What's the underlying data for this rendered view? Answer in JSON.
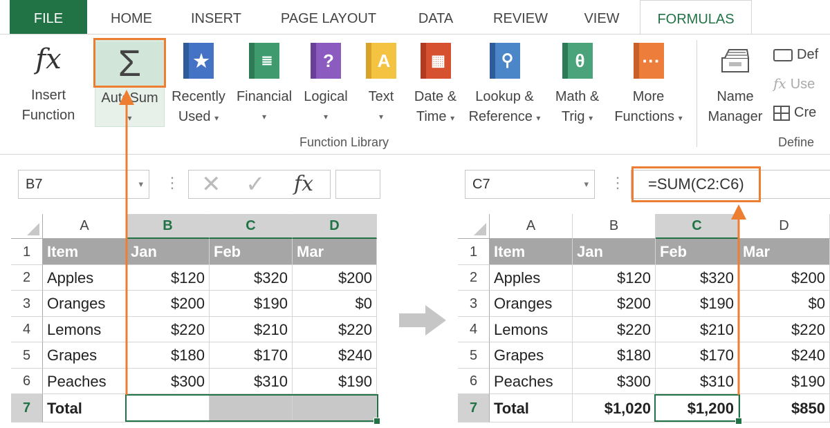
{
  "tabs": [
    "FILE",
    "HOME",
    "INSERT",
    "PAGE LAYOUT",
    "DATA",
    "REVIEW",
    "VIEW",
    "FORMULAS"
  ],
  "ribbon": {
    "insert_function": [
      "Insert",
      "Function"
    ],
    "autosum": "AutoSum",
    "recently_used": [
      "Recently",
      "Used"
    ],
    "financial": "Financial",
    "logical": "Logical",
    "text": "Text",
    "date_time": [
      "Date &",
      "Time"
    ],
    "lookup": [
      "Lookup &",
      "Reference"
    ],
    "math": [
      "Math &",
      "Trig"
    ],
    "more": [
      "More",
      "Functions"
    ],
    "name_manager": [
      "Name",
      "Manager"
    ],
    "define_items": [
      "Def",
      "Use",
      "Cre"
    ],
    "function_library_label": "Function Library",
    "defined_label": "Define"
  },
  "left": {
    "name_box": "B7",
    "formula": "",
    "col_headers": [
      "A",
      "B",
      "C",
      "D"
    ],
    "rows": [
      [
        "Item",
        "Jan",
        "Feb",
        "Mar"
      ],
      [
        "Apples",
        "$120",
        "$320",
        "$200"
      ],
      [
        "Oranges",
        "$200",
        "$190",
        "$0"
      ],
      [
        "Lemons",
        "$220",
        "$210",
        "$220"
      ],
      [
        "Grapes",
        "$180",
        "$170",
        "$240"
      ],
      [
        "Peaches",
        "$300",
        "$310",
        "$190"
      ],
      [
        "Total",
        "",
        "",
        ""
      ]
    ]
  },
  "right": {
    "name_box": "C7",
    "formula": "=SUM(C2:C6)",
    "col_headers": [
      "A",
      "B",
      "C",
      "D"
    ],
    "rows": [
      [
        "Item",
        "Jan",
        "Feb",
        "Mar"
      ],
      [
        "Apples",
        "$120",
        "$320",
        "$200"
      ],
      [
        "Oranges",
        "$200",
        "$190",
        "$0"
      ],
      [
        "Lemons",
        "$220",
        "$210",
        "$220"
      ],
      [
        "Grapes",
        "$180",
        "$170",
        "$240"
      ],
      [
        "Peaches",
        "$300",
        "$310",
        "$190"
      ],
      [
        "Total",
        "$1,020",
        "$1,200",
        "$850"
      ]
    ]
  },
  "row_numbers": [
    "1",
    "2",
    "3",
    "4",
    "5",
    "6",
    "7"
  ],
  "glyphs": {
    "fx": "fx",
    "sigma": "Σ",
    "cancel": "✕",
    "enter": "✓",
    "caret": "▾",
    "more": "⋮"
  },
  "colors": {
    "excel_green": "#217346",
    "accent_orange": "#ed7d31",
    "header_gray": "#a6a6a6"
  }
}
